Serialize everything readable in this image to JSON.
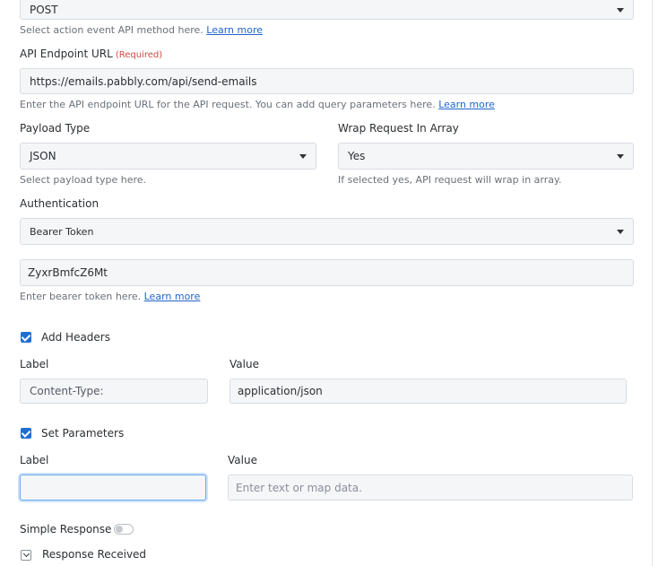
{
  "method": {
    "value": "POST",
    "help": "Select action event API method here.",
    "help_link": "Learn more"
  },
  "endpoint": {
    "label": "API Endpoint URL",
    "required": "(Required)",
    "value": "https://emails.pabbly.com/api/send-emails",
    "help": "Enter the API endpoint URL for the API request. You can add query parameters here.",
    "help_link": "Learn more"
  },
  "payload": {
    "label": "Payload Type",
    "value": "JSON",
    "help": "Select payload type here."
  },
  "wrap": {
    "label": "Wrap Request In Array",
    "value": "Yes",
    "help": "If selected yes, API request will wrap in array."
  },
  "auth": {
    "label": "Authentication",
    "value": "Bearer Token",
    "token": "ZyxrBmfcZ6Mt",
    "help": "Enter bearer token here.",
    "help_link": "Learn more"
  },
  "headers": {
    "checkbox_label": "Add Headers",
    "label_col": "Label",
    "value_col": "Value",
    "row": {
      "label": "Content-Type:",
      "value": "application/json"
    }
  },
  "params": {
    "checkbox_label": "Set Parameters",
    "label_col": "Label",
    "value_col": "Value",
    "row": {
      "label": "",
      "value_placeholder": "Enter text or map data."
    }
  },
  "simple_response": {
    "label": "Simple Response"
  },
  "response_received": {
    "label": "Response Received"
  }
}
